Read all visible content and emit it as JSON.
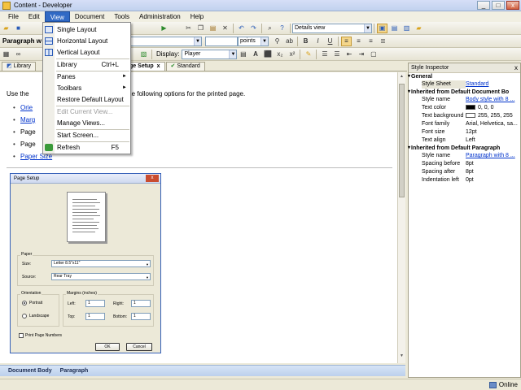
{
  "window": {
    "title": "Content - Developer",
    "minimize": "_",
    "maximize": "□",
    "close": "x"
  },
  "menubar": [
    "File",
    "Edit",
    "View",
    "Document",
    "Tools",
    "Administration",
    "Help"
  ],
  "toolbar2": {
    "paragraph_combo": "Paragraph w",
    "size_unit": "points",
    "bold": "B",
    "italic": "I",
    "underline": "U"
  },
  "toolbar1": {
    "view_combo": "Details view"
  },
  "toolbar3": {
    "display_label": "Display:",
    "display_value": "Player"
  },
  "doc_tabs": [
    {
      "label": "Library"
    },
    {
      "label": "ge Setup",
      "selected": true,
      "close": "x"
    },
    {
      "label": "Standard"
    }
  ],
  "document": {
    "intro_start": "Use the",
    "intro_end": "set the following options for the printed page.",
    "bullets": [
      {
        "text": "Orie",
        "link": true
      },
      {
        "text": "Marg",
        "link": true
      },
      {
        "text": "Page",
        "link": false
      },
      {
        "text": "Page",
        "link": false
      },
      {
        "text": "Paper Size",
        "link": true
      }
    ],
    "dialog": {
      "title": "Page Setup",
      "close": "x",
      "paper_group": "Paper",
      "size_label": "Size:",
      "size_value": "Letter 8.5\"x11\"",
      "source_label": "Source:",
      "source_value": "Rear Tray",
      "orientation_group": "Orientation",
      "portrait": "Portrait",
      "landscape": "Landscape",
      "margins_group": "Margins (inches)",
      "left_label": "Left:",
      "left_value": "1",
      "right_label": "Right:",
      "right_value": "1",
      "top_label": "Top:",
      "top_value": "1",
      "bottom_label": "Bottom:",
      "bottom_value": "1",
      "print_page_numbers": "Print Page Numbers",
      "ok": "OK",
      "cancel": "Cancel"
    }
  },
  "doc_status": [
    "Document Body",
    "Paragraph"
  ],
  "inspector": {
    "title": "Style Inspector",
    "close": "x",
    "sections": [
      {
        "title": "General",
        "rows": [
          {
            "k": "Style Sheet",
            "v": "Standard",
            "link": true,
            "hl": true
          }
        ]
      },
      {
        "title": "Inherited from Default Document Bo",
        "rows": [
          {
            "k": "Style name",
            "v": "Body style with 8 ...",
            "link": true
          },
          {
            "k": "Text color",
            "v": "0, 0, 0",
            "swatch": "#000000"
          },
          {
            "k": "Text background",
            "v": "255, 255, 255",
            "swatch": "#ffffff"
          },
          {
            "k": "Font family",
            "v": "Arial, Helvetica, sa..."
          },
          {
            "k": "Font size",
            "v": "12pt"
          },
          {
            "k": "Text align",
            "v": "Left"
          }
        ]
      },
      {
        "title": "Inherited from Default Paragraph",
        "rows": [
          {
            "k": "Style name",
            "v": "Paragraph with 8 ...",
            "link": true
          },
          {
            "k": "Spacing before",
            "v": "8pt"
          },
          {
            "k": "Spacing after",
            "v": "8pt"
          },
          {
            "k": "Indentation left",
            "v": "0pt"
          }
        ]
      }
    ]
  },
  "status": {
    "online": "Online"
  },
  "view_menu": {
    "items": [
      {
        "label": "Single Layout",
        "icon": "single-layout-icon"
      },
      {
        "label": "Horizontal Layout",
        "icon": "horizontal-layout-icon"
      },
      {
        "label": "Vertical Layout",
        "icon": "vertical-layout-icon"
      },
      {
        "label": "Library",
        "shortcut": "Ctrl+L"
      },
      {
        "label": "Panes",
        "submenu": true
      },
      {
        "label": "Toolbars",
        "submenu": true
      },
      {
        "label": "Restore Default Layout"
      },
      {
        "label": "Edit Current View...",
        "disabled": true
      },
      {
        "label": "Manage Views..."
      },
      {
        "label": "Start Screen..."
      },
      {
        "label": "Refresh",
        "shortcut": "F5",
        "icon": "refresh-icon"
      }
    ],
    "submenu_arrow": "►"
  }
}
